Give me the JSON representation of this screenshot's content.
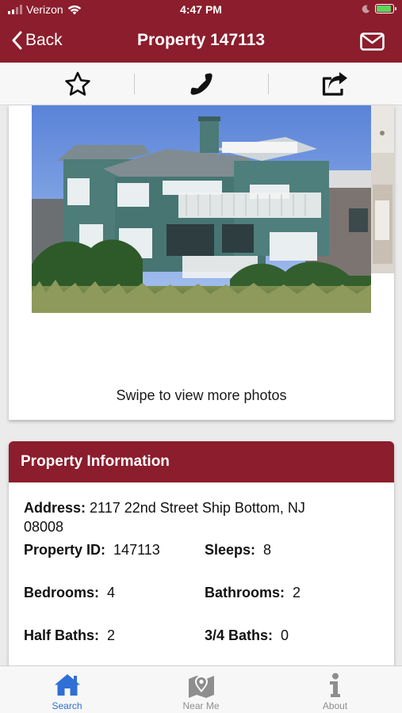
{
  "status_bar": {
    "carrier": "Verizon",
    "time": "4:47 PM"
  },
  "nav": {
    "back_label": "Back",
    "title": "Property 147113"
  },
  "toolbar": {
    "items": [
      "star-icon",
      "phone-icon",
      "share-icon"
    ]
  },
  "photo": {
    "swipe_hint": "Swipe to view more photos"
  },
  "property_info": {
    "heading": "Property Information",
    "address_label": "Address:",
    "address_value": "2117 22nd Street Ship Bottom, NJ 08008",
    "property_id_label": "Property ID:",
    "property_id_value": "147113",
    "sleeps_label": "Sleeps:",
    "sleeps_value": "8",
    "bedrooms_label": "Bedrooms:",
    "bedrooms_value": "4",
    "bathrooms_label": "Bathrooms:",
    "bathrooms_value": "2",
    "half_baths_label": "Half Baths:",
    "half_baths_value": "2",
    "three_quarter_baths_label": "3/4 Baths:",
    "three_quarter_baths_value": "0"
  },
  "tabs": [
    {
      "label": "Search",
      "icon": "home-icon",
      "active": true
    },
    {
      "label": "Near Me",
      "icon": "map-pin-icon",
      "active": false
    },
    {
      "label": "About",
      "icon": "info-icon",
      "active": false
    }
  ],
  "colors": {
    "brand": "#8b1d2c",
    "tab_active": "#2f6fd6",
    "tab_inactive": "#8e8e8e"
  }
}
